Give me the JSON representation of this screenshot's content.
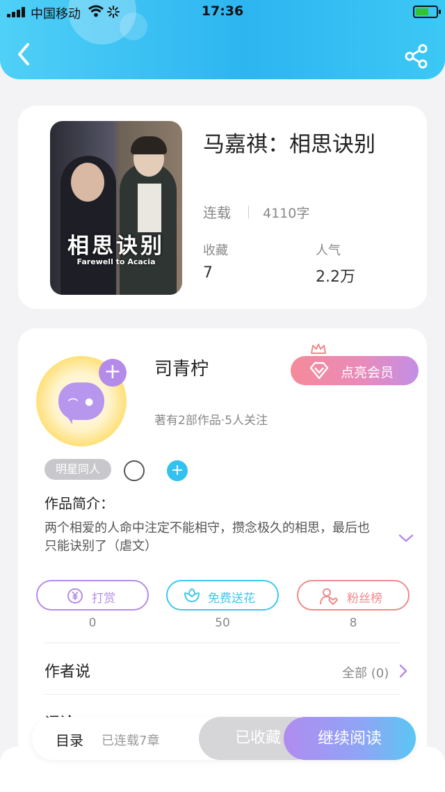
{
  "status_bar": {
    "carrier": "中国移动",
    "time": "17:36"
  },
  "book": {
    "cover_title": "相思诀别",
    "cover_subtitle": "Farewell to Acacia",
    "title": "马嘉祺：相思诀别",
    "status": "连载",
    "word_count": "4110字",
    "favorites_label": "收藏",
    "favorites_value": "7",
    "popularity_label": "人气",
    "popularity_value": "2.2万"
  },
  "author": {
    "name": "司青柠",
    "meta": "著有2部作品·5人关注",
    "vip_label": "点亮会员",
    "tag": "明星同人"
  },
  "intro": {
    "heading": "作品简介：",
    "text": "两个相爱的人命中注定不能相守，攒念极久的相思，最后也只能诀别了（虐文）"
  },
  "actions": [
    {
      "label": "打赏",
      "count": "0",
      "color": "#b48be8"
    },
    {
      "label": "免费送花",
      "count": "50",
      "color": "#3cc8ee"
    },
    {
      "label": "粉丝榜",
      "count": "8",
      "color": "#f08a8a"
    }
  ],
  "author_says": {
    "label": "作者说",
    "all_label": "全部 (0)"
  },
  "comments": {
    "label": "评论"
  },
  "bottom_bar": {
    "toc_label": "目录",
    "chapters": "已连载7章",
    "collected_label": "已收藏",
    "continue_label": "继续阅读"
  },
  "colors": {
    "header": "#2db5f0",
    "accent_purple": "#b48be8",
    "accent_cyan": "#3cc8ee",
    "accent_red": "#f08a8a"
  }
}
